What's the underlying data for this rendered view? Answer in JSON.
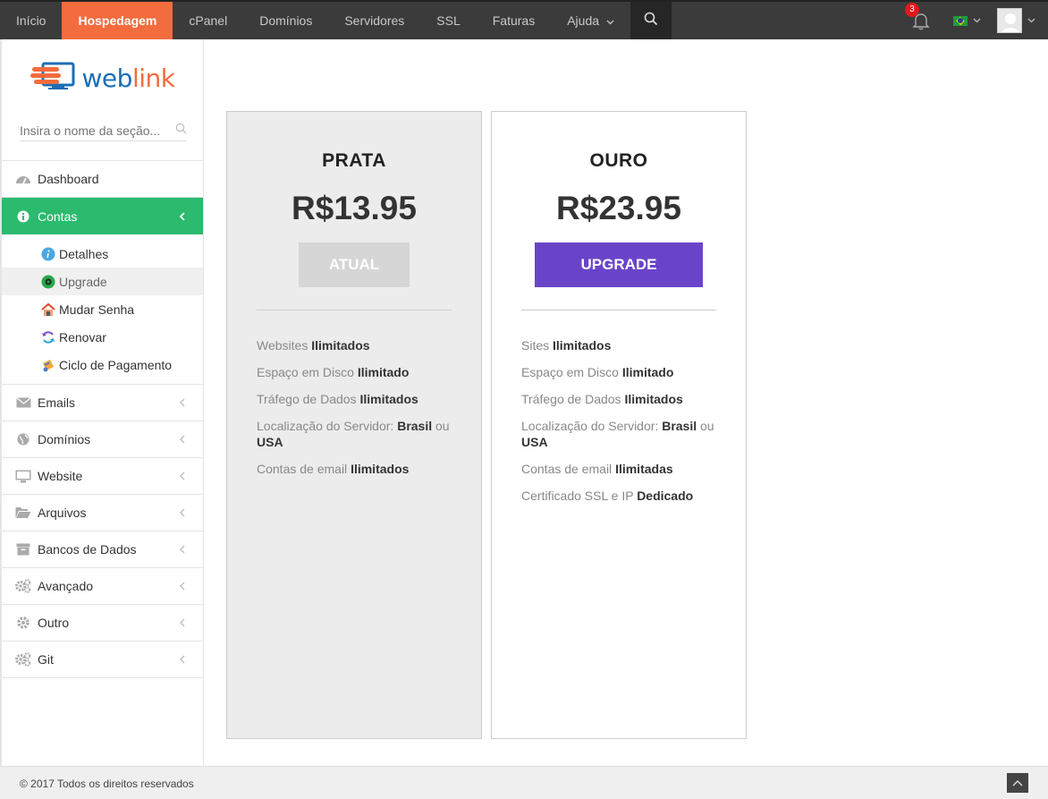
{
  "topnav": {
    "tabs": [
      {
        "label": "Início"
      },
      {
        "label": "Hospedagem",
        "active": true
      },
      {
        "label": "cPanel"
      },
      {
        "label": "Domínios"
      },
      {
        "label": "Servidores"
      },
      {
        "label": "SSL"
      },
      {
        "label": "Faturas"
      },
      {
        "label": "Ajuda"
      }
    ],
    "active_color": "#f36c3d",
    "notifications_count": "3"
  },
  "sidebar": {
    "logo": {
      "part1": "web",
      "part2": "link"
    },
    "search_placeholder": "Insira o nome da seção...",
    "items": [
      {
        "label": "Dashboard",
        "icon": "dashboard-icon"
      },
      {
        "label": "Contas",
        "icon": "info-icon",
        "active": true
      },
      {
        "label": "Emails",
        "icon": "envelope-icon"
      },
      {
        "label": "Domínios",
        "icon": "globe-icon"
      },
      {
        "label": "Website",
        "icon": "monitor-icon"
      },
      {
        "label": "Arquivos",
        "icon": "folder-open-icon"
      },
      {
        "label": "Bancos de Dados",
        "icon": "archive-icon"
      },
      {
        "label": "Avançado",
        "icon": "gears-icon"
      },
      {
        "label": "Outro",
        "icon": "gear-icon"
      },
      {
        "label": "Git",
        "icon": "gears-icon"
      }
    ],
    "subitems": [
      {
        "label": "Detalhes",
        "icon": "info-circle-icon"
      },
      {
        "label": "Upgrade",
        "icon": "upgrade-icon"
      },
      {
        "label": "Mudar Senha",
        "icon": "house-lock-icon"
      },
      {
        "label": "Renovar",
        "icon": "refresh-icon"
      },
      {
        "label": "Ciclo de Pagamento",
        "icon": "billing-cycle-icon"
      }
    ],
    "active_color": "#2cba6f"
  },
  "plans": [
    {
      "name": "PRATA",
      "price": "R$13.95",
      "button": "ATUAL",
      "features": [
        [
          "Websites ",
          "Ilimitados",
          ""
        ],
        [
          "Espaço em Disco ",
          "Ilimitado",
          ""
        ],
        [
          "Tráfego de Dados ",
          "Ilimitados",
          ""
        ],
        [
          "Localização do Servidor: ",
          "Brasil",
          " ou "
        ],
        [
          "Contas de email ",
          "Ilimitados",
          ""
        ]
      ]
    },
    {
      "name": "OURO",
      "price": "R$23.95",
      "button": "UPGRADE",
      "button_color": "#6a44c8",
      "features": [
        [
          "Sites ",
          "Ilimitados",
          ""
        ],
        [
          "Espaço em Disco ",
          "Ilimitado",
          ""
        ],
        [
          "Tráfego de Dados ",
          "Ilimitados",
          ""
        ],
        [
          "Localização do Servidor: ",
          "Brasil",
          " ou "
        ],
        [
          "Contas de email ",
          "Ilimitadas",
          ""
        ],
        [
          "Certificado SSL e IP ",
          "Dedicado",
          ""
        ]
      ]
    }
  ],
  "location_extra": "USA",
  "footer": {
    "copyright": "© 2017 Todos os direitos reservados"
  }
}
